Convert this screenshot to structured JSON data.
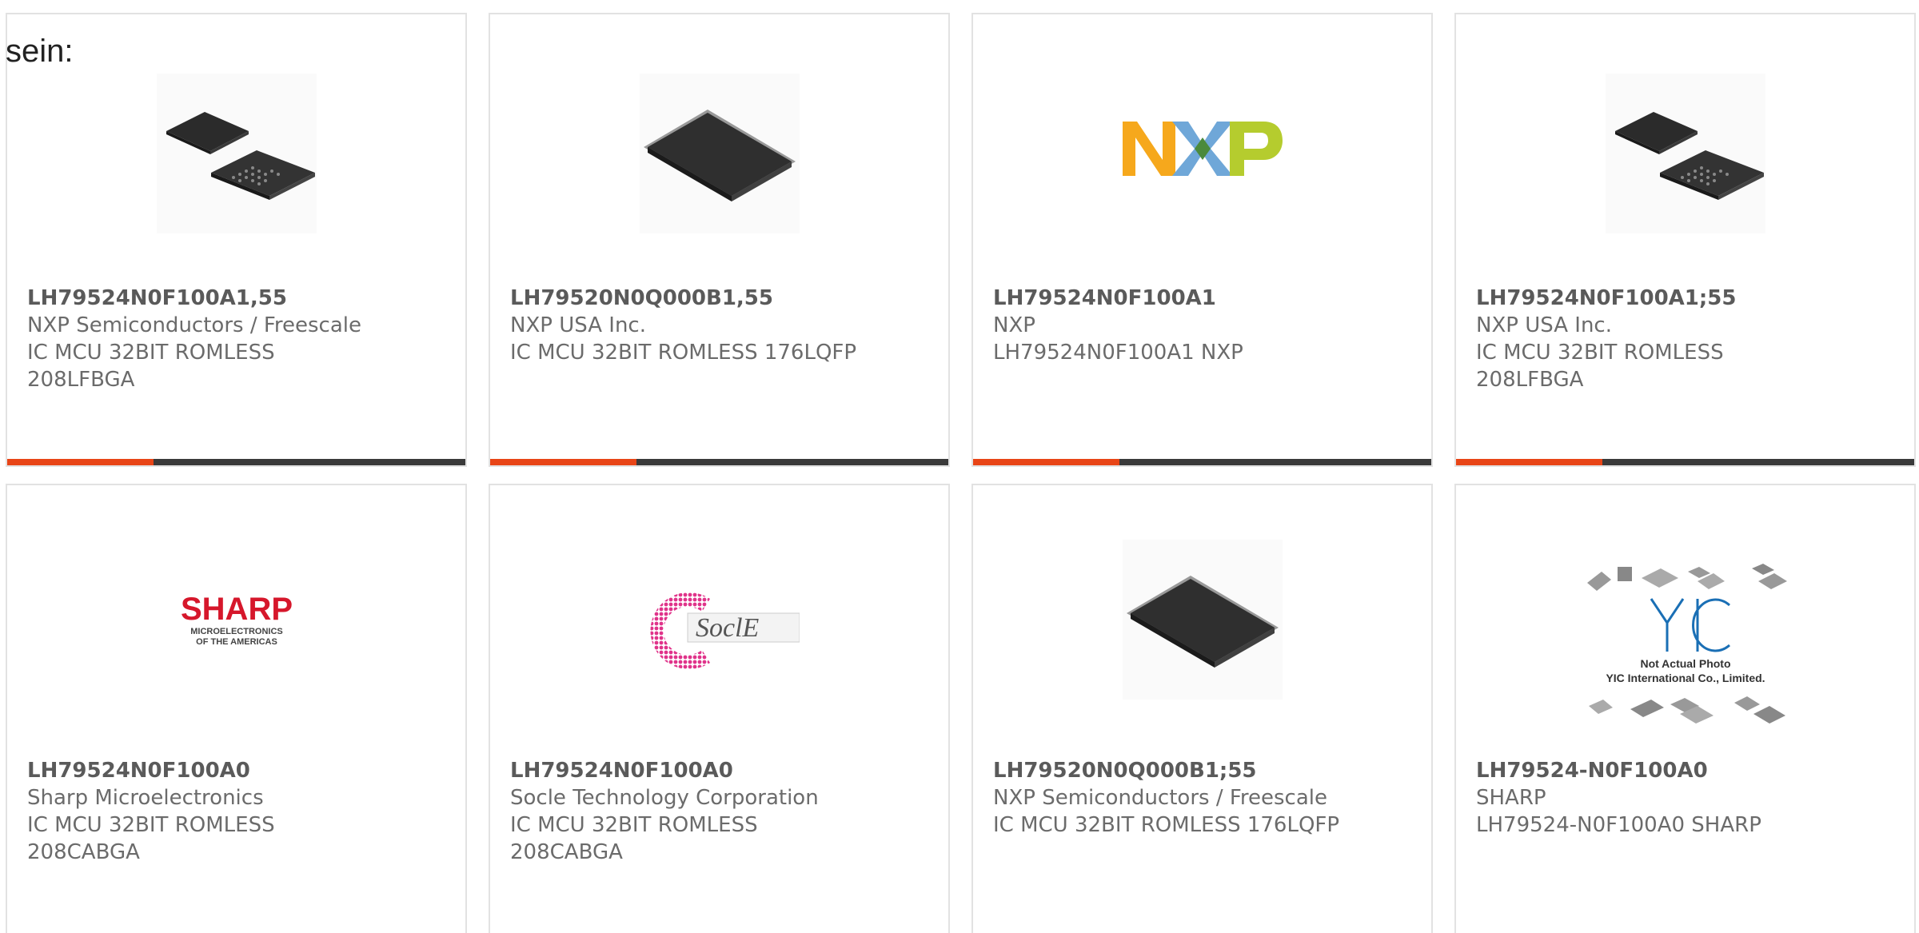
{
  "intro_text": "sein:",
  "colors": {
    "accent": "#e84517",
    "bar": "#3a3a3a",
    "border": "#e2e2e2",
    "text": "#6b6b6b"
  },
  "products": [
    {
      "part_number": "LH79524N0F100A1,55",
      "manufacturer": "NXP Semiconductors / Freescale",
      "desc_line1": "IC MCU 32BIT ROMLESS",
      "desc_line2": "208LFBGA",
      "image": "bga-chip-pair"
    },
    {
      "part_number": "LH79520N0Q000B1,55",
      "manufacturer": "NXP USA Inc.",
      "desc_line1": "IC MCU 32BIT ROMLESS 176LQFP",
      "desc_line2": "",
      "image": "lqfp-chip"
    },
    {
      "part_number": "LH79524N0F100A1",
      "manufacturer": "NXP",
      "desc_line1": "LH79524N0F100A1 NXP",
      "desc_line2": "",
      "image": "nxp-logo",
      "logo_text": "NXP"
    },
    {
      "part_number": "LH79524N0F100A1;55",
      "manufacturer": "NXP USA Inc.",
      "desc_line1": "IC MCU 32BIT ROMLESS",
      "desc_line2": "208LFBGA",
      "image": "bga-chip-pair"
    },
    {
      "part_number": "LH79524N0F100A0",
      "manufacturer": "Sharp Microelectronics",
      "desc_line1": "IC MCU 32BIT ROMLESS",
      "desc_line2": "208CABGA",
      "image": "sharp-logo",
      "logo_text": "SHARP",
      "logo_sub1": "MICROELECTRONICS",
      "logo_sub2": "OF THE AMERICAS"
    },
    {
      "part_number": "LH79524N0F100A0",
      "manufacturer": "Socle Technology Corporation",
      "desc_line1": "IC MCU 32BIT ROMLESS",
      "desc_line2": "208CABGA",
      "image": "socle-logo",
      "logo_text": "SoclE"
    },
    {
      "part_number": "LH79520N0Q000B1;55",
      "manufacturer": "NXP Semiconductors / Freescale",
      "desc_line1": "IC MCU 32BIT ROMLESS 176LQFP",
      "desc_line2": "",
      "image": "lqfp-chip"
    },
    {
      "part_number": "LH79524-N0F100A0",
      "manufacturer": "SHARP",
      "desc_line1": "LH79524-N0F100A0 SHARP",
      "desc_line2": "",
      "image": "yic-placeholder",
      "logo_text": "YIC",
      "logo_sub1": "Not Actual Photo",
      "logo_sub2": "YIC International Co., Limited."
    }
  ]
}
